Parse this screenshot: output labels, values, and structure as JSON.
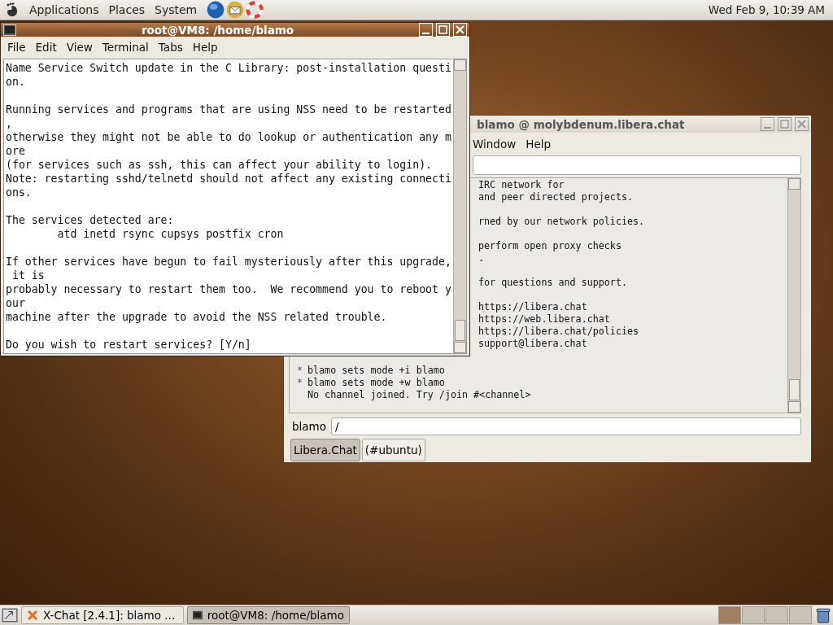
{
  "top_panel": {
    "menus": [
      "Applications",
      "Places",
      "System"
    ],
    "clock": "Wed Feb  9, 10:39 AM"
  },
  "terminal": {
    "title": "root@VM8: /home/blamo",
    "menu": [
      "File",
      "Edit",
      "View",
      "Terminal",
      "Tabs",
      "Help"
    ],
    "paragraphs": [
      [
        "Name Service Switch update in the C Library: post-installation questi",
        "on."
      ],
      [
        "Running services and programs that are using NSS need to be restarted",
        ",",
        "otherwise they might not be able to do lookup or authentication any m",
        "ore",
        "(for services such as ssh, this can affect your ability to login).",
        "Note: restarting sshd/telnetd should not affect any existing connecti",
        "ons."
      ],
      [
        "The services detected are:",
        "        atd inetd rsync cupsys postfix cron"
      ],
      [
        "If other services have begun to fail mysteriously after this upgrade,",
        " it is",
        "probably necessary to restart them too.  We recommend you to reboot y",
        "our",
        "machine after the upgrade to avoid the NSS related trouble."
      ],
      [
        "Do you wish to restart services? [Y/n]"
      ]
    ]
  },
  "xchat": {
    "title": "blamo @ molybdenum.libera.chat",
    "menu": [
      "Window",
      "Help"
    ],
    "upper_paragraphs": [
      [
        "IRC network for",
        "and peer directed projects."
      ],
      [
        "rned by our network policies."
      ],
      [
        "perform open proxy checks",
        "."
      ],
      [
        "for questions and support."
      ],
      [
        "https://libera.chat",
        "https://web.libera.chat",
        "https://libera.chat/policies",
        "support@libera.chat"
      ]
    ],
    "lower_lines": [
      {
        "marker": "*",
        "text": "blamo sets mode +i blamo"
      },
      {
        "marker": "*",
        "text": "blamo sets mode +w blamo"
      },
      {
        "text": "No channel joined. Try /join #<channel>"
      }
    ],
    "nick": "blamo",
    "input": "/",
    "tabs": [
      {
        "label": "Libera.Chat",
        "selected": true
      },
      {
        "label": "(#ubuntu)",
        "selected": false
      }
    ]
  },
  "taskbar": {
    "tasks": [
      {
        "label": "X-Chat [2.4.1]: blamo ...",
        "kind": "xchat",
        "selected": false
      },
      {
        "label": "root@VM8: /home/blamo",
        "kind": "terminal",
        "selected": true
      }
    ],
    "workspaces": [
      {
        "selected": true
      },
      {
        "selected": false
      },
      {
        "selected": false
      },
      {
        "selected": false
      }
    ]
  }
}
